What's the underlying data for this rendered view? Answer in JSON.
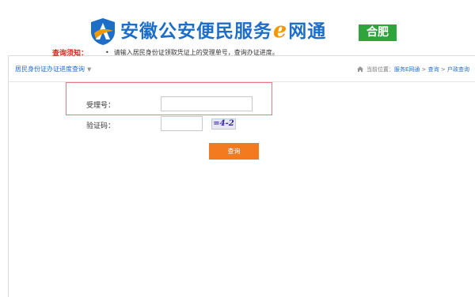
{
  "header": {
    "title_before": "安徽公安便民服务",
    "title_e": "e",
    "title_after": "网通",
    "city_badge": "合肥"
  },
  "panel": {
    "title": "居民身份证办证进度查询",
    "caret": "▼",
    "breadcrumb": {
      "prefix": "当前位置：",
      "items": [
        "服务E网通",
        "查询",
        "户政查询"
      ],
      "separator": ">"
    }
  },
  "notice": {
    "label": "查询须知：",
    "bullet": "•",
    "text": "请输入居民身份证领取凭证上的受理单号，查询办证进度。"
  },
  "form": {
    "receipt_label": "受理号：",
    "receipt_value": "",
    "captcha_label": "验证码：",
    "captcha_value": "",
    "captcha_image_text": "=4-2",
    "submit_label": "查询"
  },
  "colors": {
    "brand_blue": "#1d6ec8",
    "badge_green": "#2fa43c",
    "notice_red": "#d9251c",
    "button_orange": "#f47a1f",
    "highlight_border": "#e57a85"
  }
}
